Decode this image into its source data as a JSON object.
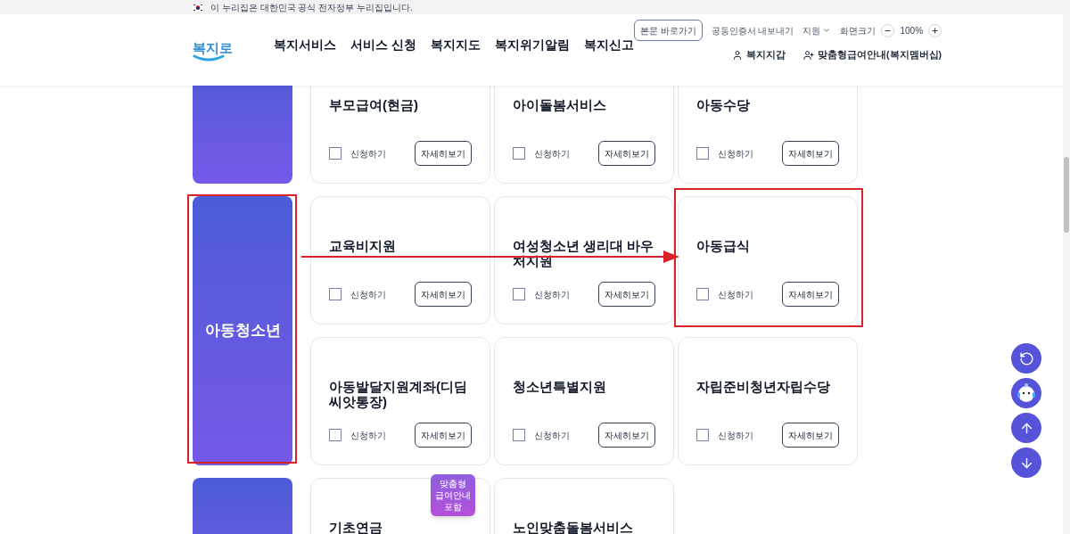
{
  "gov_banner": {
    "text": "이 누리집은 대한민국 공식 전자정부 누리집입니다."
  },
  "header": {
    "logo": "복지로",
    "nav": [
      "복지서비스",
      "서비스 신청",
      "복지지도",
      "복지위기알림",
      "복지신고"
    ],
    "utility": [
      {
        "kind": "button",
        "label": "본문 바로가기"
      },
      {
        "kind": "link",
        "label": "공동인증서 내보내기"
      },
      {
        "kind": "dropdown",
        "label": "지원"
      },
      {
        "kind": "zoom",
        "label": "화면크기",
        "value": "100%"
      }
    ],
    "account": [
      {
        "kind": "user",
        "label": "복지지갑"
      },
      {
        "kind": "user-plus",
        "label": "맞춤형급여안내(복지멤버십)"
      }
    ]
  },
  "sections": [
    {
      "items": [
        {
          "title": "부모급여(현금)",
          "apply": "신청하기",
          "checked": false,
          "detail": "자세히보기"
        },
        {
          "title": "아이돌봄서비스",
          "apply": "신청하기",
          "checked": false,
          "detail": "자세히보기"
        },
        {
          "title": "아동수당",
          "apply": "신청하기",
          "checked": false,
          "detail": "자세히보기"
        }
      ]
    },
    {
      "category": "아동청소년",
      "highlighted": true,
      "items": [
        {
          "title": "교육비지원",
          "apply": "신청하기",
          "checked": false,
          "detail": "자세히보기"
        },
        {
          "title": "여성청소년 생리대 바우처지원",
          "apply": "신청하기",
          "checked": false,
          "detail": "자세히보기"
        },
        {
          "title": "아동급식",
          "apply": "신청하기",
          "checked": false,
          "detail": "자세히보기",
          "highlighted": true
        },
        {
          "title": "아동발달지원계좌(디딤씨앗통장)",
          "apply": "신청하기",
          "checked": false,
          "detail": "자세히보기"
        },
        {
          "title": "청소년특별지원",
          "apply": "신청하기",
          "checked": false,
          "detail": "자세히보기"
        },
        {
          "title": "자립준비청년자립수당",
          "apply": "신청하기",
          "checked": false,
          "detail": "자세히보기"
        }
      ]
    },
    {
      "items": [
        {
          "title": "기초연금",
          "badge": "맞춤형 급여안내 포함"
        },
        {
          "title": "노인맞춤돌봄서비스"
        }
      ]
    }
  ],
  "floating_buttons": [
    {
      "kind": "history"
    },
    {
      "kind": "chatbot"
    },
    {
      "kind": "up"
    },
    {
      "kind": "down"
    }
  ]
}
